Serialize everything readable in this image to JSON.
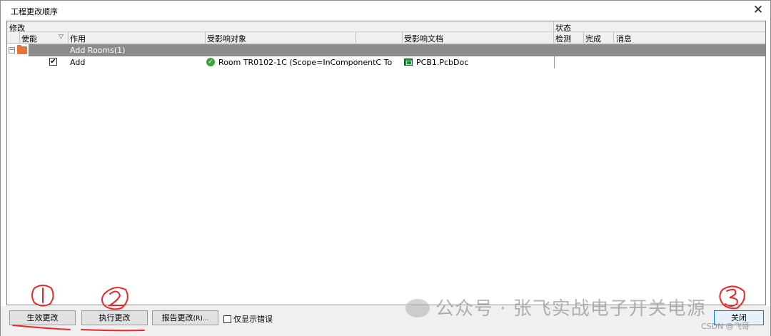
{
  "window": {
    "title": "工程更改顺序",
    "close_glyph": "✕"
  },
  "header": {
    "group_modify": "修改",
    "group_status": "状态",
    "col_enable": "使能",
    "col_filter_glyph": "▽",
    "col_action": "作用",
    "col_affected_object": "受影响对象",
    "col_affected_doc": "受影响文档",
    "col_check": "检测",
    "col_done": "完成",
    "col_message": "消息"
  },
  "rows": [
    {
      "group_label": "Add Rooms(1)",
      "expander": "−",
      "items": [
        {
          "enabled_glyph": "✔",
          "action": "Add",
          "object": "Room TR0102-1C (Scope=InComponentC To",
          "document": "PCB1.PcbDoc",
          "check": "",
          "done": "",
          "message": ""
        }
      ]
    }
  ],
  "buttons": {
    "validate": "生效更改",
    "execute": "执行更改",
    "report": "报告更改(R)",
    "report_shortcut": "(R)...",
    "close": "关闭"
  },
  "filter_checkbox": {
    "label": "仅显示错误"
  },
  "annotations": {
    "mark1": "①",
    "mark2": "②",
    "mark3": "③"
  },
  "watermark": {
    "text": "公众号 · 张飞实战电子开关电源",
    "csdn": "CSDN @飞哥"
  },
  "colors": {
    "accent": "#0078d7",
    "group_row": "#8c8c8c",
    "annotation": "#e8282b",
    "ok": "#3aa43a",
    "folder": "#e8743b"
  }
}
